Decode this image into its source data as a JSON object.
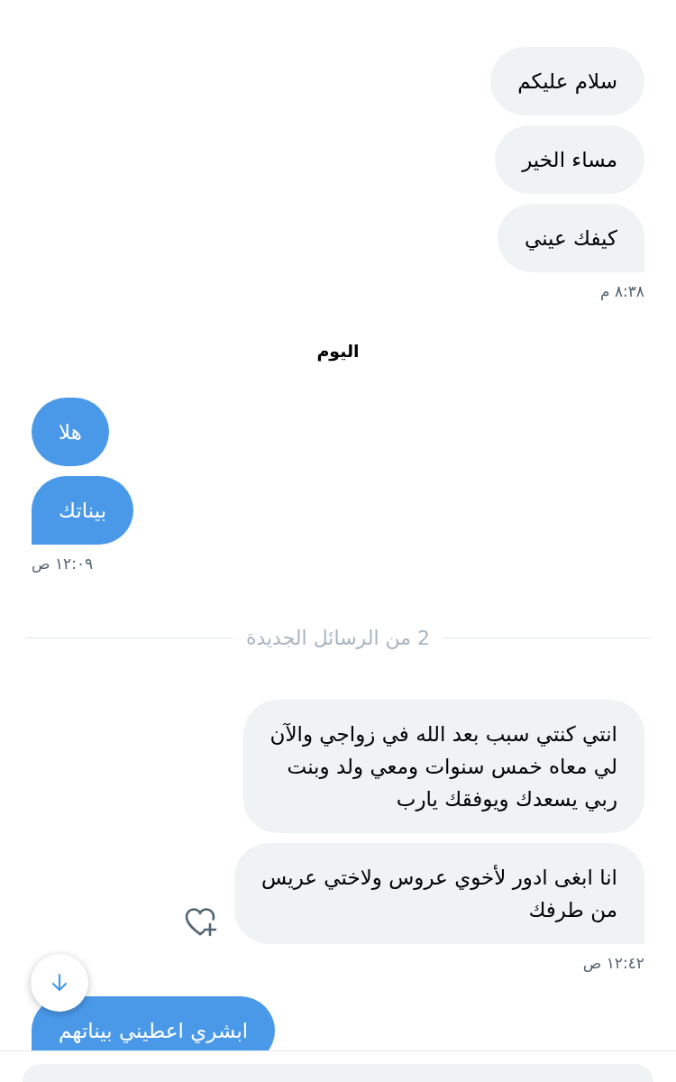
{
  "conversation": [
    {
      "kind": "outgoing",
      "messages": [
        {
          "text": "سلام عليكم",
          "like_button": false
        },
        {
          "text": "مساء الخير",
          "like_button": false
        },
        {
          "text": "كيفك عيني",
          "like_button": false
        }
      ],
      "time": "٨:٣٨ م"
    },
    {
      "kind": "day",
      "label": "اليوم"
    },
    {
      "kind": "incoming",
      "messages": [
        {
          "text": "هلا",
          "like_button": false
        },
        {
          "text": "بيناتك",
          "like_button": false
        }
      ],
      "time": "١٢:٠٩ ص"
    },
    {
      "kind": "divider",
      "label": "2 من الرسائل الجديدة"
    },
    {
      "kind": "outgoing",
      "messages": [
        {
          "text": "انتي كنتي سبب بعد الله في زواجي والآن\nلي معاه خمس سنوات ومعي ولد وبنت\nربي يسعدك ويوفقك يارب",
          "like_button": false
        },
        {
          "text": "انا ابغى ادور لأخوي عروس ولاختي عريس\nمن طرفك",
          "like_button": true
        }
      ],
      "time": "١٢:٤٢ ص"
    },
    {
      "kind": "incoming",
      "messages": [
        {
          "text": "ابشري اعطيني بيناتهم",
          "like_button": false
        }
      ]
    }
  ]
}
